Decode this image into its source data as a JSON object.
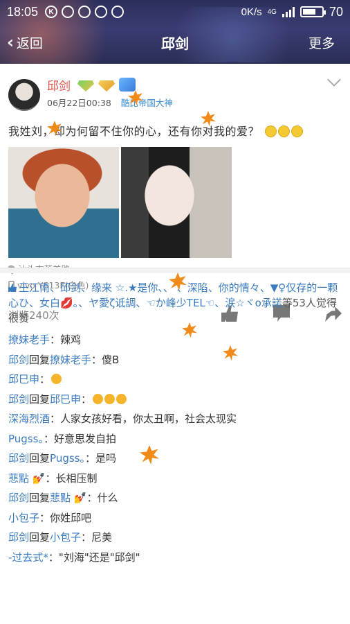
{
  "status_bar": {
    "time": "18:05",
    "network_speed": "0K/s",
    "network_type": "4G",
    "battery": "70",
    "battery_level": 0.7
  },
  "nav": {
    "back_label": "返回",
    "title": "邱剑",
    "more_label": "更多"
  },
  "post": {
    "author": "邱剑",
    "timestamp": "06月22日00:38",
    "rank_title": "酷比帝国大神",
    "text": "我姓刘，却为何留不住你的心，还有你对我的爱？",
    "location": "汕头市莱美路",
    "device": "vivo Y613F(白色)",
    "views": "浏览240次"
  },
  "likes": {
    "names": "王江南、邱剑、缘来 ☆.★是你、、 、深陷、你的情々、▼♀仅存的一颗心ひ、女白💋。、ヤ愛ζ诋調、☜か峰少TEL☜、涙☆ヾo承諾",
    "suffix": "等53人觉得很赞"
  },
  "comments": [
    {
      "name": "撩妹老手",
      "text": "：辣鸡"
    },
    {
      "name": "邱剑",
      "reply_label": "回复",
      "target": "撩妹老手",
      "text": "：傻B"
    },
    {
      "name": "邱巳申",
      "text": "："
    },
    {
      "name": "邱剑",
      "reply_label": "回复",
      "target": "邱巳申",
      "text": "："
    },
    {
      "name": "深海烈酒",
      "text": "：人家女孩好看，你太丑啊，社会太现实"
    },
    {
      "name": "Pugss。",
      "text": "：好意思发自拍"
    },
    {
      "name": "邱剑",
      "reply_label": "回复",
      "target": "Pugss。",
      "text": "：是吗"
    },
    {
      "name": "蕜點 💅",
      "text": "：长相压制"
    },
    {
      "name": "邱剑",
      "reply_label": "回复",
      "target": "蕜點 💅",
      "text": "：什么"
    },
    {
      "name": "小包子",
      "text": "：你姓邱吧"
    },
    {
      "name": "邱剑",
      "reply_label": "回复",
      "target": "小包子",
      "text": "：尼美"
    },
    {
      "name": "-过去式*",
      "text": "：\"刘海\"还是\"邱剑\""
    }
  ],
  "colors": {
    "name_red": "#e0524a",
    "link_blue": "#3a7bc0",
    "header_navy": "#2e315f"
  }
}
